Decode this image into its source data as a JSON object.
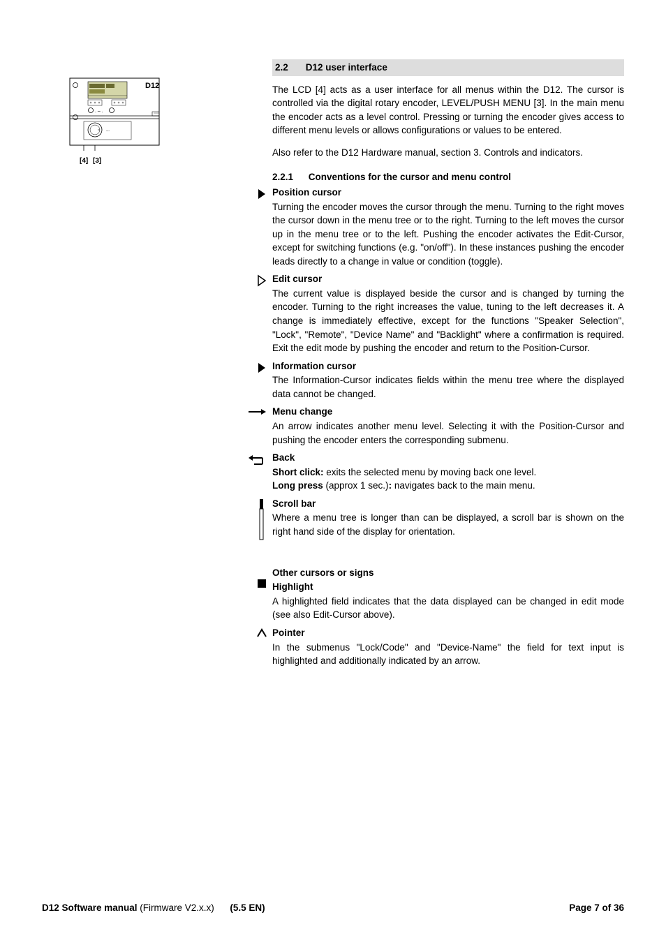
{
  "device": {
    "label": "D12",
    "ref4": "[4]",
    "ref3": "[3]"
  },
  "section": {
    "num": "2.2",
    "title": "D12 user interface",
    "para1": "The LCD [4] acts as a user interface for all menus within the D12. The cursor is controlled via the digital rotary encoder, LEVEL/PUSH MENU [3]. In the main menu the encoder acts as a level control. Pressing or turning the encoder gives access to different menu levels or allows configurations or values to be entered.",
    "para2": "Also refer to the D12 Hardware manual, section 3. Controls and indicators."
  },
  "subsection": {
    "num": "2.2.1",
    "title": "Conventions for the cursor and menu control"
  },
  "position": {
    "heading": "Position cursor",
    "body": "Turning the encoder moves the cursor through the menu. Turning to the right moves the cursor down in the menu tree or to the right. Turning to the left moves the cursor up in the menu tree or to the left. Pushing the encoder activates the Edit-Cursor, except for switching functions (e.g. \"on/off\"). In these instances pushing the encoder leads directly to a change in value or condition (toggle)."
  },
  "edit": {
    "heading": "Edit cursor",
    "body": "The current value is displayed beside the cursor and is changed by turning the encoder. Turning to the right increases the value, tuning to the left decreases it. A change is immediately effective, except for the functions \"Speaker Selection\", \"Lock\", \"Remote\", \"Device Name\" and \"Backlight\" where a confirmation is required. Exit the edit mode by pushing the encoder and return to the Position-Cursor."
  },
  "info": {
    "heading": "Information cursor",
    "body": "The Information-Cursor indicates fields within the menu tree where the displayed data cannot be changed."
  },
  "menuchange": {
    "heading": "Menu change",
    "body": "An arrow indicates another menu level. Selecting it with the Position-Cursor and pushing the encoder enters the corresponding submenu."
  },
  "back": {
    "heading": "Back",
    "short_label": "Short click:",
    "short_body": " exits the selected menu by moving back one level.",
    "long_label": "Long press",
    "long_paren": " (approx 1 sec.)",
    "long_colon": ":",
    "long_body": " navigates back to the main menu."
  },
  "scroll": {
    "heading": "Scroll bar",
    "body": "Where a menu tree is longer than can be displayed, a scroll bar is shown on the right hand side of the display for orientation."
  },
  "other_heading": "Other cursors or signs",
  "highlight": {
    "heading": "Highlight",
    "body": "A highlighted field indicates that the data displayed can be changed in edit mode (see also Edit-Cursor above)."
  },
  "pointer": {
    "heading": "Pointer",
    "body": "In the submenus \"Lock/Code\" and \"Device-Name\" the field for text input is highlighted and additionally indicated by an arrow."
  },
  "footer": {
    "title_bold": "D12 Software manual",
    "title_rest": " (Firmware V2.x.x)",
    "mid": "(5.5 EN)",
    "right": "Page 7 of 36"
  }
}
